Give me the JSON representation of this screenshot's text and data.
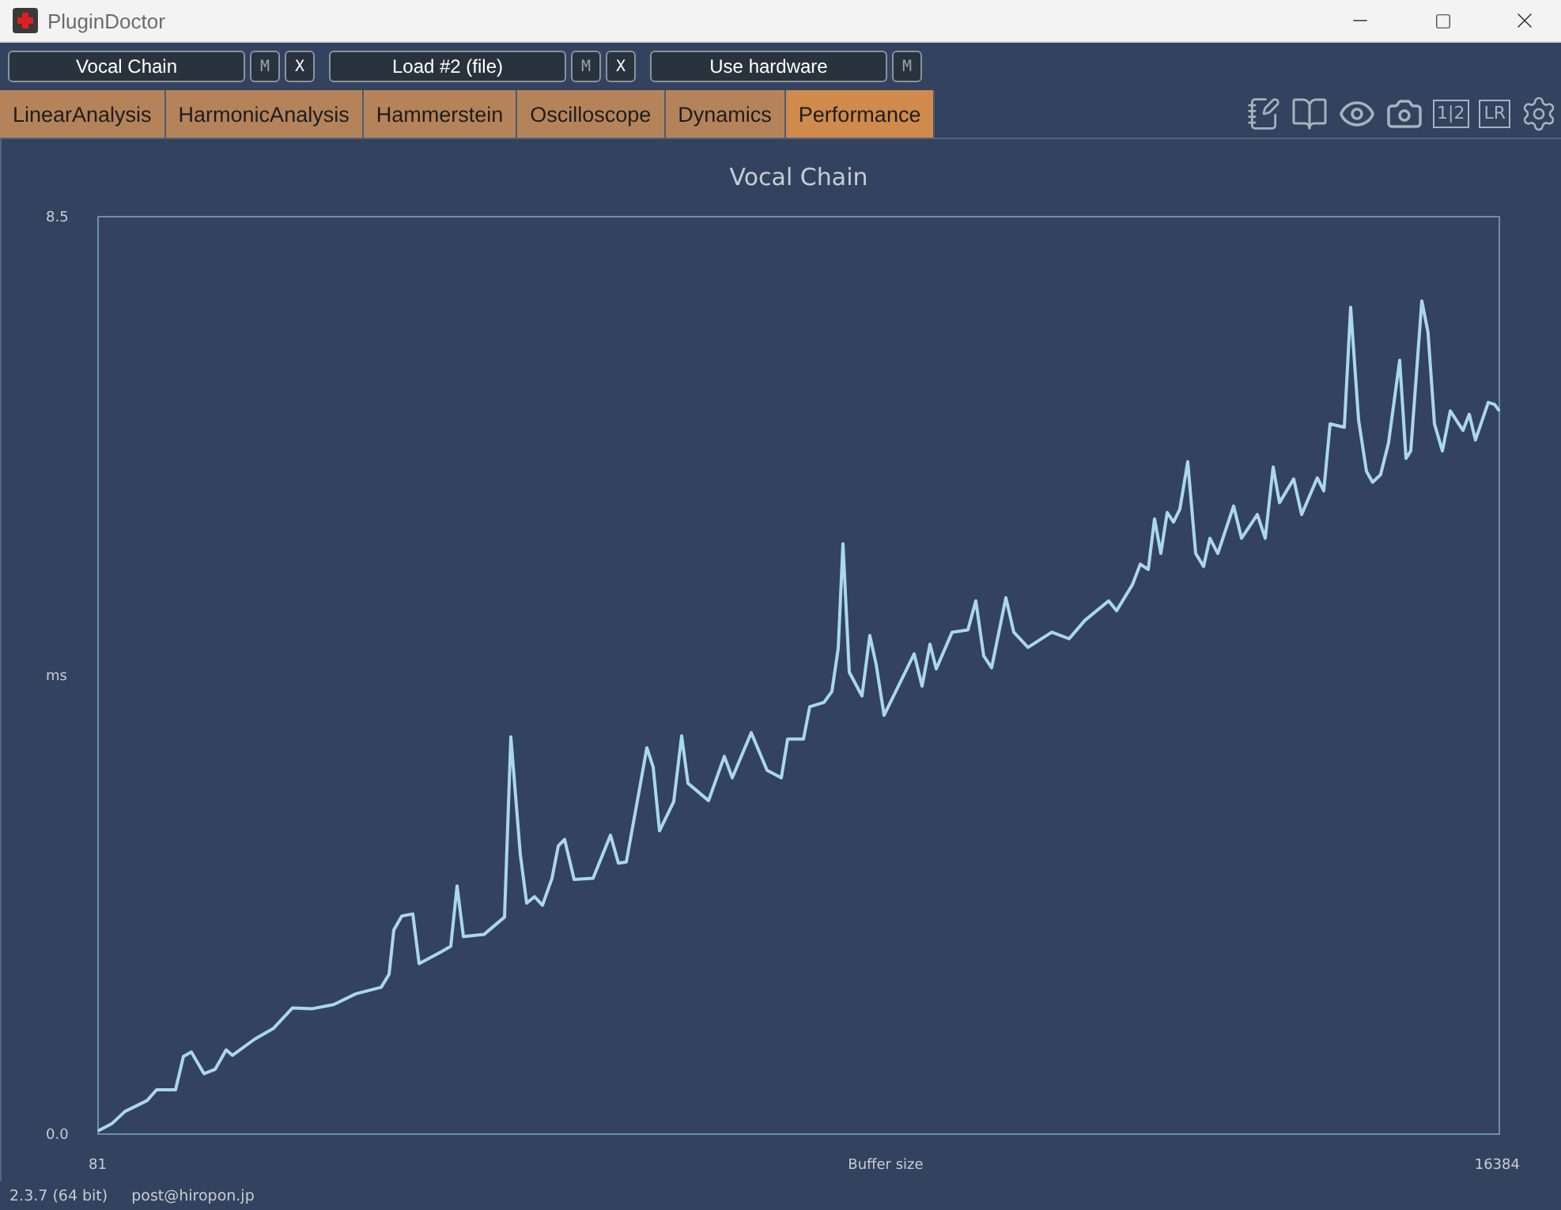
{
  "window": {
    "title": "PluginDoctor"
  },
  "slots": [
    {
      "label": "Vocal Chain",
      "buttons": [
        {
          "label": "M",
          "kind": "toggle"
        },
        {
          "label": "X",
          "kind": "remove"
        }
      ]
    },
    {
      "label": "Load #2 (file)",
      "buttons": [
        {
          "label": "M",
          "kind": "toggle"
        },
        {
          "label": "X",
          "kind": "remove"
        }
      ]
    },
    {
      "label": "Use hardware",
      "buttons": [
        {
          "label": "M",
          "kind": "toggle"
        }
      ]
    }
  ],
  "tabs": [
    {
      "label": "LinearAnalysis",
      "selected": false
    },
    {
      "label": "HarmonicAnalysis",
      "selected": false
    },
    {
      "label": "Hammerstein",
      "selected": false
    },
    {
      "label": "Oscilloscope",
      "selected": false
    },
    {
      "label": "Dynamics",
      "selected": false
    },
    {
      "label": "Performance",
      "selected": true
    }
  ],
  "view_buttons": [
    "1|2",
    "LR"
  ],
  "chart": {
    "chart_data": {
      "type": "line",
      "title": "Vocal Chain",
      "xlabel": "Buffer size",
      "ylabel": "ms",
      "xlim": [
        81,
        16384
      ],
      "ylim": [
        0,
        8.5
      ],
      "xticks": [
        81,
        16384
      ],
      "yticks": [
        {
          "value": 0,
          "label": "0.0"
        },
        {
          "value": 8.5,
          "label": "8.5"
        }
      ],
      "x": [
        81,
        247,
        394,
        651,
        762,
        983,
        1075,
        1167,
        1314,
        1443,
        1571,
        1645,
        1903,
        2123,
        2344,
        2565,
        2823,
        3080,
        3375,
        3467,
        3522,
        3614,
        3743,
        3816,
        4074,
        4184,
        4258,
        4331,
        4571,
        4810,
        4883,
        4994,
        5067,
        5159,
        5251,
        5362,
        5435,
        5509,
        5619,
        5840,
        6043,
        6135,
        6227,
        6392,
        6466,
        6539,
        6613,
        6779,
        6871,
        6944,
        7183,
        7367,
        7459,
        7680,
        7864,
        8030,
        8103,
        8287,
        8361,
        8527,
        8619,
        8692,
        8747,
        8821,
        8968,
        9060,
        9134,
        9226,
        9410,
        9575,
        9667,
        9759,
        9833,
        10017,
        10201,
        10293,
        10385,
        10477,
        10643,
        10735,
        10900,
        11176,
        11379,
        11563,
        11839,
        11931,
        12115,
        12207,
        12299,
        12372,
        12446,
        12519,
        12593,
        12667,
        12759,
        12851,
        12943,
        13016,
        13108,
        13292,
        13384,
        13568,
        13660,
        13752,
        13826,
        13991,
        14083,
        14267,
        14341,
        14415,
        14580,
        14654,
        14746,
        14838,
        14911,
        15003,
        15095,
        15224,
        15298,
        15353,
        15482,
        15555,
        15629,
        15721,
        15813,
        15960,
        16034,
        16107,
        16255,
        16328,
        16384
      ],
      "series": [
        {
          "color": "#a9d8ea",
          "values": [
            0.03,
            0.1,
            0.21,
            0.31,
            0.41,
            0.41,
            0.72,
            0.76,
            0.56,
            0.6,
            0.78,
            0.73,
            0.88,
            0.98,
            1.17,
            1.16,
            1.2,
            1.3,
            1.36,
            1.48,
            1.89,
            2.02,
            2.04,
            1.58,
            1.69,
            1.74,
            2.3,
            1.83,
            1.85,
            2.01,
            3.68,
            2.59,
            2.14,
            2.2,
            2.12,
            2.37,
            2.67,
            2.73,
            2.36,
            2.37,
            2.77,
            2.51,
            2.52,
            3.25,
            3.58,
            3.4,
            2.81,
            3.08,
            3.69,
            3.25,
            3.09,
            3.5,
            3.3,
            3.72,
            3.37,
            3.3,
            3.66,
            3.66,
            3.96,
            4.0,
            4.1,
            4.5,
            5.47,
            4.28,
            4.06,
            4.62,
            4.35,
            3.88,
            4.18,
            4.45,
            4.15,
            4.54,
            4.31,
            4.65,
            4.67,
            4.94,
            4.43,
            4.32,
            4.97,
            4.65,
            4.51,
            4.65,
            4.59,
            4.76,
            4.94,
            4.85,
            5.09,
            5.28,
            5.23,
            5.7,
            5.38,
            5.76,
            5.67,
            5.79,
            6.23,
            5.38,
            5.26,
            5.52,
            5.38,
            5.82,
            5.52,
            5.74,
            5.52,
            6.18,
            5.85,
            6.07,
            5.74,
            6.08,
            5.96,
            6.58,
            6.55,
            7.66,
            6.62,
            6.14,
            6.04,
            6.11,
            6.4,
            7.17,
            6.26,
            6.33,
            7.72,
            7.43,
            6.58,
            6.33,
            6.7,
            6.52,
            6.67,
            6.43,
            6.78,
            6.76,
            6.7
          ]
        }
      ]
    }
  },
  "status_bar": {
    "version": "2.3.7 (64 bit)",
    "contact": "post@hiropon.jp"
  }
}
